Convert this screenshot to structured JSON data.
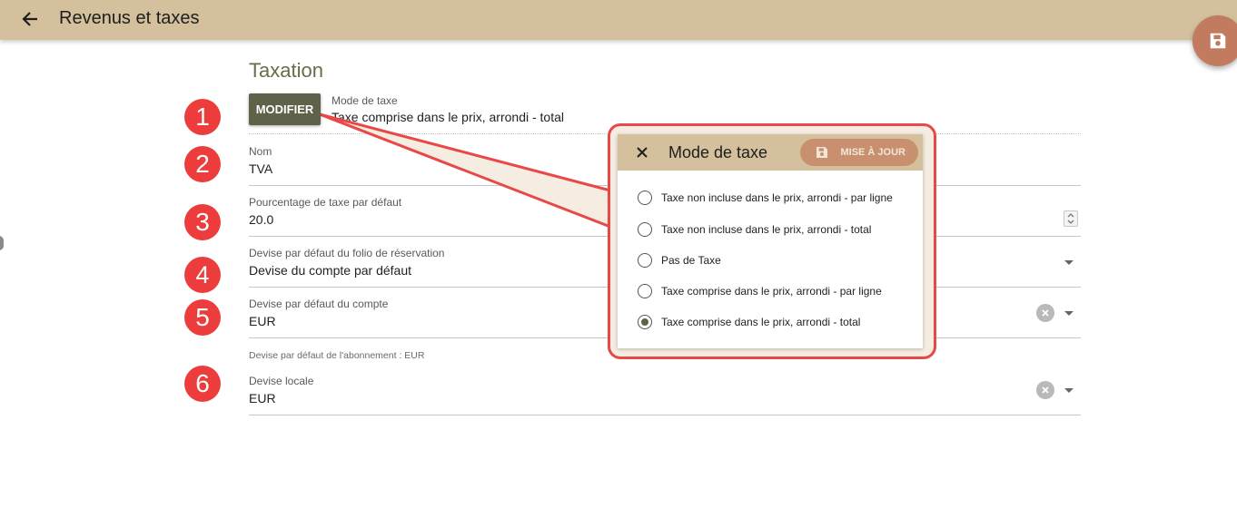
{
  "header": {
    "title": "Revenus et taxes",
    "back_icon": "arrow-back-icon",
    "background": "#d4c09c"
  },
  "fab": {
    "icon": "save-icon",
    "color": "#c37b60"
  },
  "section": {
    "title": "Taxation"
  },
  "tax_mode": {
    "button_label": "MODIFIER",
    "label": "Mode de taxe",
    "value": "Taxe comprise dans le prix, arrondi - total"
  },
  "fields": {
    "nom": {
      "label": "Nom",
      "value": "TVA"
    },
    "pourcentage": {
      "label": "Pourcentage de taxe par défaut",
      "value": "20.0"
    },
    "devise_folio": {
      "label": "Devise par défaut du folio de réservation",
      "value": "Devise du compte par défaut"
    },
    "devise_compte": {
      "label": "Devise par défaut du compte",
      "value": "EUR"
    },
    "devise_locale": {
      "label": "Devise locale",
      "value": "EUR"
    }
  },
  "hint": "Devise par défaut de l'abonnement : EUR",
  "markers": [
    "1",
    "2",
    "3",
    "4",
    "5",
    "6"
  ],
  "popup": {
    "title": "Mode de taxe",
    "close_icon": "close-icon",
    "update_label": "MISE À JOUR",
    "options": [
      {
        "label": "Taxe non incluse dans le prix, arrondi - par ligne",
        "selected": false
      },
      {
        "label": "Taxe non incluse dans le prix, arrondi - total",
        "selected": false
      },
      {
        "label": "Pas de Taxe",
        "selected": false
      },
      {
        "label": "Taxe comprise dans le prix, arrondi - par ligne",
        "selected": false
      },
      {
        "label": "Taxe comprise dans le prix, arrondi - total",
        "selected": true
      }
    ]
  },
  "colors": {
    "accent": "#5f6248",
    "marker": "#ec3c3c",
    "callout_border": "#e94848",
    "callout_fill": "#f5ede1"
  }
}
